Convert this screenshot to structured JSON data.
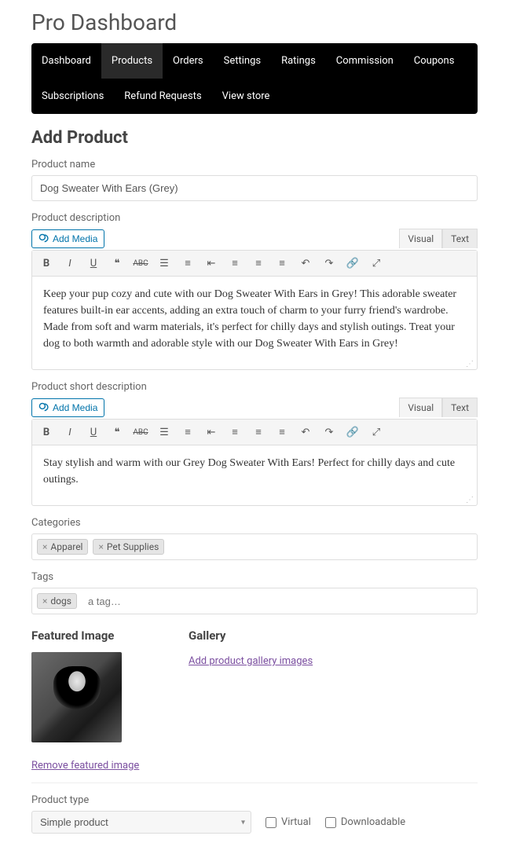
{
  "header": {
    "title": "Pro Dashboard"
  },
  "nav": {
    "items": [
      "Dashboard",
      "Products",
      "Orders",
      "Settings",
      "Ratings",
      "Commission",
      "Coupons",
      "Subscriptions",
      "Refund Requests",
      "View store"
    ],
    "active": "Products"
  },
  "page": {
    "title": "Add Product"
  },
  "form": {
    "name_label": "Product name",
    "name_value": "Dog Sweater With Ears (Grey)",
    "desc_label": "Product description",
    "add_media": "Add Media",
    "tab_visual": "Visual",
    "tab_text": "Text",
    "desc_value": "Keep your pup cozy and cute with our Dog Sweater With Ears in Grey! This adorable sweater features built-in ear accents, adding an extra touch of charm to your furry friend's wardrobe. Made from soft and warm materials, it's perfect for chilly days and stylish outings. Treat your dog to both warmth and adorable style with our Dog Sweater With Ears in Grey!",
    "short_label": "Product short description",
    "short_value": "Stay stylish and warm with our Grey Dog Sweater With Ears! Perfect for chilly days and cute outings.",
    "categories_label": "Categories",
    "categories": [
      "Apparel",
      "Pet Supplies"
    ],
    "tags_label": "Tags",
    "tags": [
      "dogs"
    ],
    "tag_placeholder": "a tag…",
    "featured_title": "Featured Image",
    "gallery_title": "Gallery",
    "gallery_link": "Add product gallery images",
    "remove_link": "Remove featured image",
    "type_label": "Product type",
    "type_value": "Simple product",
    "virtual_label": "Virtual",
    "downloadable_label": "Downloadable"
  }
}
